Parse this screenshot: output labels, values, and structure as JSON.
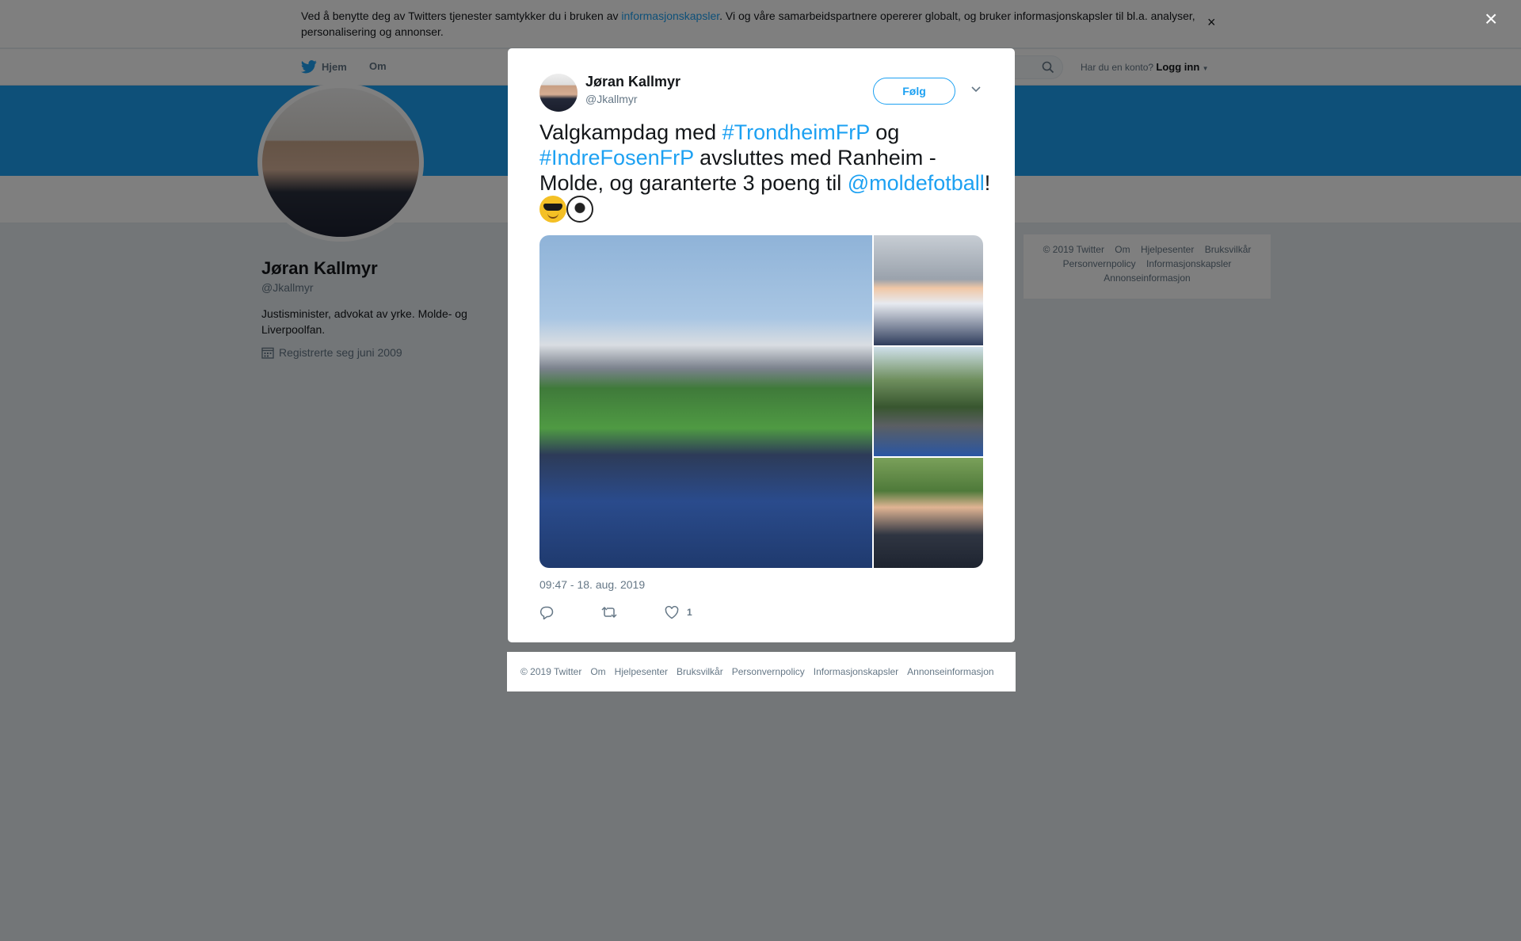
{
  "cookie_banner": {
    "text_before": "Ved å benytte deg av Twitters tjenester samtykker du i bruken av ",
    "link": "informasjonskapsler",
    "text_after": ". Vi og våre samarbeidspartnere opererer globalt, og bruker informasjonskapsler til bl.a. analyser, personalisering og annonser.",
    "close": "×"
  },
  "nav": {
    "home": "Hjem",
    "about": "Om",
    "login_prompt": "Har du en konto?",
    "login": "Logg inn"
  },
  "profile": {
    "name": "Jøran Kallmyr",
    "handle": "@Jkallmyr",
    "bio": "Justisminister, advokat av yrke. Molde- og Liverpoolfan.",
    "joined": "Registrerte seg juni 2009"
  },
  "side_footer": {
    "links": [
      "© 2019 Twitter",
      "Om",
      "Hjelpesenter",
      "Bruksvilkår",
      "Personvernpolicy",
      "Informasjonskapsler",
      "Annonseinformasjon"
    ]
  },
  "overlay": {
    "close": "×"
  },
  "tweet": {
    "author_name": "Jøran Kallmyr",
    "author_handle": "@Jkallmyr",
    "follow_label": "Følg",
    "text": {
      "p1": "Valgkampdag med ",
      "tag1": "#TrondheimFrP",
      "p2": " og ",
      "tag2": "#IndreFosenFrP",
      "p3": " avsluttes med Ranheim - Molde, og garanterte 3 poeng til ",
      "mention": "@moldefotball",
      "p4": "!"
    },
    "timestamp": "09:47 - 18. aug. 2019",
    "like_count": "1"
  },
  "modal_footer": {
    "links": [
      "© 2019 Twitter",
      "Om",
      "Hjelpesenter",
      "Bruksvilkår",
      "Personvernpolicy",
      "Informasjonskapsler",
      "Annonseinformasjon"
    ]
  },
  "colors": {
    "accent": "#1da1f2",
    "muted": "#657786",
    "text": "#14171a"
  }
}
